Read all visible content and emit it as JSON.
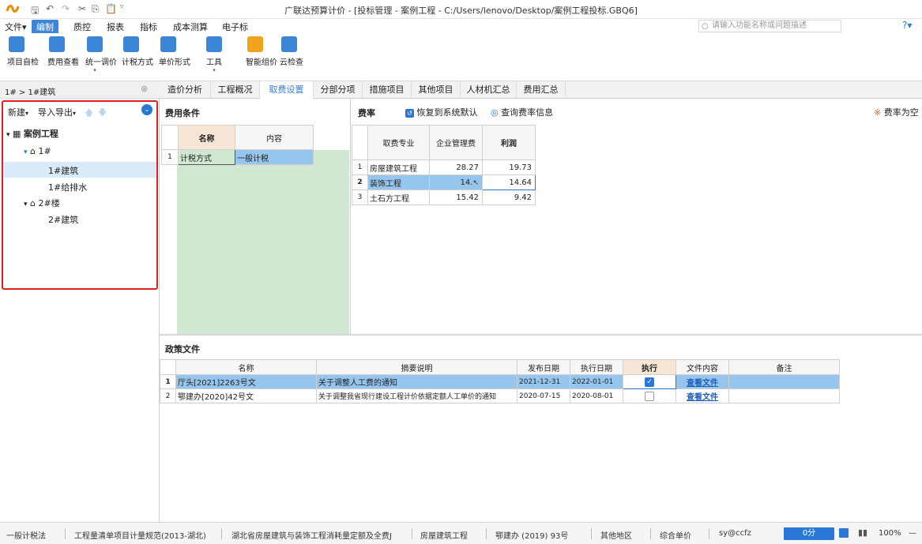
{
  "window": {
    "title": "广联达预算计价 - [投标管理 - 案例工程 - C:/Users/lenovo/Desktop/案例工程投标.GBQ6]",
    "help_glyph": "?"
  },
  "menus": [
    "文件",
    "编制",
    "质控",
    "报表",
    "指标",
    "成本测算",
    "电子标"
  ],
  "search": {
    "placeholder": "请输入功能名称或问题描述"
  },
  "ribbon": [
    {
      "label": "项目自检",
      "color": "#3a85d6"
    },
    {
      "label": "费用查看",
      "color": "#3a85d6"
    },
    {
      "label": "统一调价",
      "color": "#3a85d6",
      "arrow": "▾"
    },
    {
      "label": "计税方式",
      "color": "#3a85d6"
    },
    {
      "label": "单价形式",
      "color": "#3a85d6"
    },
    {
      "label": "工具",
      "color": "#3a85d6",
      "arrow": "▾"
    },
    {
      "label": "智能组价",
      "color": "#f1a31a"
    },
    {
      "label": "云检查",
      "color": "#3a85d6"
    }
  ],
  "left": {
    "breadcrumb": "1# > 1#建筑",
    "new_label": "新建",
    "import_label": "导入导出",
    "tree": [
      {
        "label": "案例工程",
        "level": 0,
        "expander": "▾"
      },
      {
        "label": "1#",
        "level": 1,
        "expander": "▾"
      },
      {
        "label": "1#建筑",
        "level": 2,
        "selected": true
      },
      {
        "label": "1#给排水",
        "level": 2
      },
      {
        "label": "2#楼",
        "level": 1,
        "expander": "▾"
      },
      {
        "label": "2#建筑",
        "level": 2
      }
    ]
  },
  "tabs": [
    "造价分析",
    "工程概况",
    "取费设置",
    "分部分项",
    "措施项目",
    "其他项目",
    "人材机汇总",
    "费用汇总"
  ],
  "active_tab": "取费设置",
  "fee_conditions": {
    "title": "费用条件",
    "headers": [
      "名称",
      "内容"
    ],
    "rows": [
      {
        "idx": "1",
        "name": "计税方式",
        "content": "一般计税"
      }
    ]
  },
  "fee_rate": {
    "title": "费率",
    "restore_label": "恢复到系统默认",
    "query_label": "查询费率信息",
    "right_note": "费率为空",
    "headers": [
      "取费专业",
      "企业管理费",
      "利润"
    ],
    "rows": [
      {
        "idx": "1",
        "name": "房屋建筑工程",
        "mgmt": "28.27",
        "profit": "19.73"
      },
      {
        "idx": "2",
        "name": "装饰工程",
        "mgmt": "14.",
        "profit": "14.64"
      },
      {
        "idx": "3",
        "name": "土石方工程",
        "mgmt": "15.42",
        "profit": "9.42"
      }
    ]
  },
  "policy": {
    "title": "政策文件",
    "headers": [
      "名称",
      "摘要说明",
      "发布日期",
      "执行日期",
      "执行",
      "文件内容",
      "备注"
    ],
    "rows": [
      {
        "idx": "1",
        "name": "厅头[2021]2263号文",
        "desc": "关于调整人工费的通知",
        "pub": "2021-12-31",
        "exec": "2022-01-01",
        "checked": true,
        "file": "查看文件",
        "note": ""
      },
      {
        "idx": "2",
        "name": "鄂建办[2020]42号文",
        "desc": "关于调整我省现行建设工程计价依据定额人工单价的通知",
        "pub": "2020-07-15",
        "exec": "2020-08-01",
        "checked": false,
        "file": "查看文件",
        "note": ""
      }
    ]
  },
  "status": {
    "items": [
      "一般计税法",
      "工程量清单项目计量规范(2013-湖北)",
      "湖北省房屋建筑与装饰工程消耗量定额及全费J",
      "房屋建筑工程",
      "鄂建办 (2019) 93号",
      "其他地区",
      "综合单价",
      "sy@ccfz"
    ],
    "score": "0分",
    "zoom": "100%",
    "zoom_out": "—"
  }
}
